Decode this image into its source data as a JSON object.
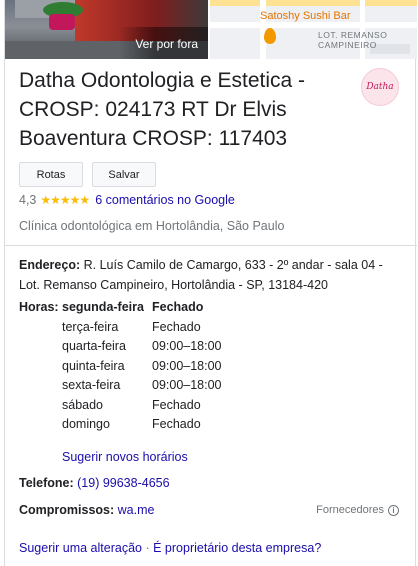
{
  "photos": {
    "street_caption": "Ver por fora",
    "map": {
      "poi_label": "Satoshy Sushi Bar",
      "area_label_line1": "LOT. REMANSO",
      "area_label_line2": "CAMPINEIRO"
    }
  },
  "business": {
    "title": "Datha Odontologia e Estetica - CROSP: 024173 RT Dr Elvis Boaventura CROSP: 117403",
    "logo_text": "Datha",
    "category": "Clínica odontológica em Hortolândia, São Paulo"
  },
  "actions": {
    "routes_label": "Rotas",
    "save_label": "Salvar"
  },
  "rating": {
    "value": "4,3",
    "stars": "★★★★★",
    "reviews_label": "6 comentários no Google"
  },
  "address": {
    "label": "Endereço:",
    "value": "R. Luís Camilo de Camargo, 633 - 2º andar - sala 04 - Lot. Remanso Campineiro, Hortolândia - SP, 13184-420"
  },
  "hours": {
    "label": "Horas:",
    "rows": [
      {
        "day": "segunda-feira",
        "time": "Fechado"
      },
      {
        "day": "terça-feira",
        "time": "Fechado"
      },
      {
        "day": "quarta-feira",
        "time": "09:00–18:00"
      },
      {
        "day": "quinta-feira",
        "time": "09:00–18:00"
      },
      {
        "day": "sexta-feira",
        "time": "09:00–18:00"
      },
      {
        "day": "sábado",
        "time": "Fechado"
      },
      {
        "day": "domingo",
        "time": "Fechado"
      }
    ],
    "suggest_label": "Sugerir novos horários"
  },
  "phone": {
    "label": "Telefone:",
    "value": "(19) 99638-4656"
  },
  "commitments": {
    "label": "Compromissos:",
    "value": "wa.me"
  },
  "suppliers_label": "Fornecedores",
  "footer": {
    "suggest_edit": "Sugerir uma alteração",
    "separator": "·",
    "owner": "É proprietário desta empresa?"
  },
  "colors": {
    "link": "#1a0dab",
    "star": "#fbbc04",
    "muted": "#70757a"
  }
}
